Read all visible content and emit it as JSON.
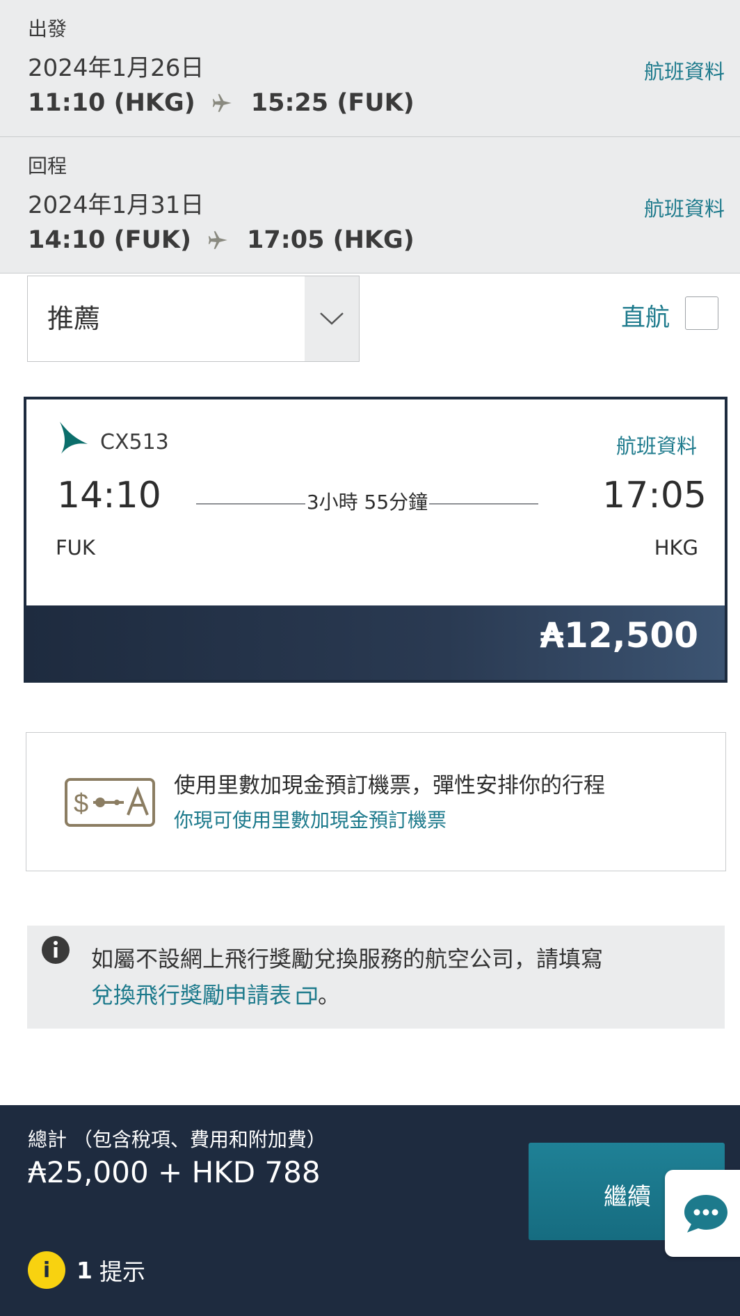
{
  "outbound": {
    "label": "出發",
    "date": "2024年1月26日",
    "depart": "11:10 (HKG)",
    "arrive": "15:25 (FUK)",
    "details_link": "航班資料"
  },
  "return": {
    "label": "回程",
    "date": "2024年1月31日",
    "depart": "14:10 (FUK)",
    "arrive": "17:05 (HKG)",
    "details_link": "航班資料"
  },
  "filters": {
    "sort_value": "推薦",
    "direct_label": "直航",
    "direct_checked": false
  },
  "flight": {
    "number": "CX513",
    "details_link": "航班資料",
    "dep_time": "14:10",
    "arr_time": "17:05",
    "duration": "3小時 55分鐘",
    "dep_code": "FUK",
    "arr_code": "HKG",
    "price": "₳12,500"
  },
  "promo": {
    "title": "使用里數加現金預訂機票，彈性安排你的行程",
    "link": "你現可使用里數加現金預訂機票"
  },
  "info": {
    "text": "如屬不設網上飛行獎勵兌換服務的航空公司，請填寫",
    "link": "兌換飛行獎勵申請表",
    "suffix": "。"
  },
  "summary": {
    "total_label": "總計 （包含稅項、費用和附加費）",
    "total_value": "₳25,000 + HKD 788",
    "continue_label": "繼續",
    "hint_count": "1",
    "hint_label": "提示"
  },
  "colors": {
    "link": "#1d7a8c",
    "navy": "#1e2b3f",
    "teal_button": "#1f8196",
    "hint_yellow": "#f8d210",
    "panel_grey": "#ebeced"
  },
  "icons": [
    "plane-icon",
    "chevron-down-icon",
    "cathay-logo-icon",
    "miles-cash-icon",
    "info-icon",
    "external-link-icon",
    "chat-icon",
    "hint-icon"
  ]
}
